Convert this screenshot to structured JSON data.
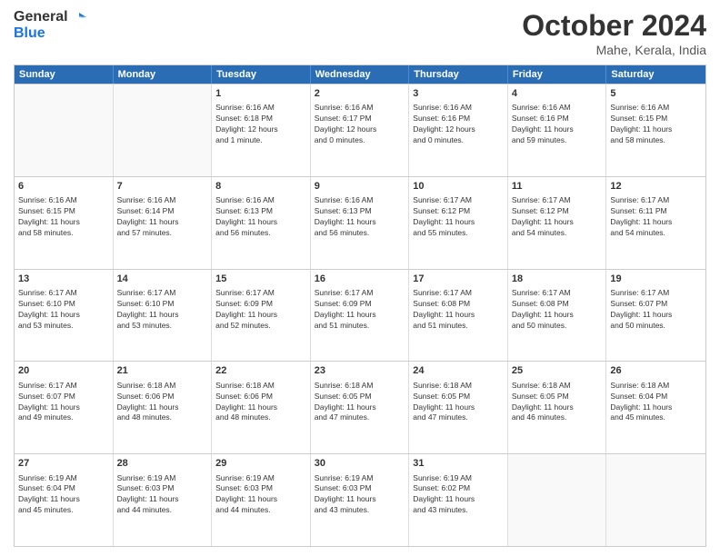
{
  "logo": {
    "line1": "General",
    "line2": "Blue"
  },
  "title": "October 2024",
  "subtitle": "Mahe, Kerala, India",
  "header_days": [
    "Sunday",
    "Monday",
    "Tuesday",
    "Wednesday",
    "Thursday",
    "Friday",
    "Saturday"
  ],
  "weeks": [
    [
      {
        "day": "",
        "empty": true
      },
      {
        "day": "",
        "empty": true
      },
      {
        "day": "1",
        "l1": "Sunrise: 6:16 AM",
        "l2": "Sunset: 6:18 PM",
        "l3": "Daylight: 12 hours",
        "l4": "and 1 minute."
      },
      {
        "day": "2",
        "l1": "Sunrise: 6:16 AM",
        "l2": "Sunset: 6:17 PM",
        "l3": "Daylight: 12 hours",
        "l4": "and 0 minutes."
      },
      {
        "day": "3",
        "l1": "Sunrise: 6:16 AM",
        "l2": "Sunset: 6:16 PM",
        "l3": "Daylight: 12 hours",
        "l4": "and 0 minutes."
      },
      {
        "day": "4",
        "l1": "Sunrise: 6:16 AM",
        "l2": "Sunset: 6:16 PM",
        "l3": "Daylight: 11 hours",
        "l4": "and 59 minutes."
      },
      {
        "day": "5",
        "l1": "Sunrise: 6:16 AM",
        "l2": "Sunset: 6:15 PM",
        "l3": "Daylight: 11 hours",
        "l4": "and 58 minutes."
      }
    ],
    [
      {
        "day": "6",
        "l1": "Sunrise: 6:16 AM",
        "l2": "Sunset: 6:15 PM",
        "l3": "Daylight: 11 hours",
        "l4": "and 58 minutes."
      },
      {
        "day": "7",
        "l1": "Sunrise: 6:16 AM",
        "l2": "Sunset: 6:14 PM",
        "l3": "Daylight: 11 hours",
        "l4": "and 57 minutes."
      },
      {
        "day": "8",
        "l1": "Sunrise: 6:16 AM",
        "l2": "Sunset: 6:13 PM",
        "l3": "Daylight: 11 hours",
        "l4": "and 56 minutes."
      },
      {
        "day": "9",
        "l1": "Sunrise: 6:16 AM",
        "l2": "Sunset: 6:13 PM",
        "l3": "Daylight: 11 hours",
        "l4": "and 56 minutes."
      },
      {
        "day": "10",
        "l1": "Sunrise: 6:17 AM",
        "l2": "Sunset: 6:12 PM",
        "l3": "Daylight: 11 hours",
        "l4": "and 55 minutes."
      },
      {
        "day": "11",
        "l1": "Sunrise: 6:17 AM",
        "l2": "Sunset: 6:12 PM",
        "l3": "Daylight: 11 hours",
        "l4": "and 54 minutes."
      },
      {
        "day": "12",
        "l1": "Sunrise: 6:17 AM",
        "l2": "Sunset: 6:11 PM",
        "l3": "Daylight: 11 hours",
        "l4": "and 54 minutes."
      }
    ],
    [
      {
        "day": "13",
        "l1": "Sunrise: 6:17 AM",
        "l2": "Sunset: 6:10 PM",
        "l3": "Daylight: 11 hours",
        "l4": "and 53 minutes."
      },
      {
        "day": "14",
        "l1": "Sunrise: 6:17 AM",
        "l2": "Sunset: 6:10 PM",
        "l3": "Daylight: 11 hours",
        "l4": "and 53 minutes."
      },
      {
        "day": "15",
        "l1": "Sunrise: 6:17 AM",
        "l2": "Sunset: 6:09 PM",
        "l3": "Daylight: 11 hours",
        "l4": "and 52 minutes."
      },
      {
        "day": "16",
        "l1": "Sunrise: 6:17 AM",
        "l2": "Sunset: 6:09 PM",
        "l3": "Daylight: 11 hours",
        "l4": "and 51 minutes."
      },
      {
        "day": "17",
        "l1": "Sunrise: 6:17 AM",
        "l2": "Sunset: 6:08 PM",
        "l3": "Daylight: 11 hours",
        "l4": "and 51 minutes."
      },
      {
        "day": "18",
        "l1": "Sunrise: 6:17 AM",
        "l2": "Sunset: 6:08 PM",
        "l3": "Daylight: 11 hours",
        "l4": "and 50 minutes."
      },
      {
        "day": "19",
        "l1": "Sunrise: 6:17 AM",
        "l2": "Sunset: 6:07 PM",
        "l3": "Daylight: 11 hours",
        "l4": "and 50 minutes."
      }
    ],
    [
      {
        "day": "20",
        "l1": "Sunrise: 6:17 AM",
        "l2": "Sunset: 6:07 PM",
        "l3": "Daylight: 11 hours",
        "l4": "and 49 minutes."
      },
      {
        "day": "21",
        "l1": "Sunrise: 6:18 AM",
        "l2": "Sunset: 6:06 PM",
        "l3": "Daylight: 11 hours",
        "l4": "and 48 minutes."
      },
      {
        "day": "22",
        "l1": "Sunrise: 6:18 AM",
        "l2": "Sunset: 6:06 PM",
        "l3": "Daylight: 11 hours",
        "l4": "and 48 minutes."
      },
      {
        "day": "23",
        "l1": "Sunrise: 6:18 AM",
        "l2": "Sunset: 6:05 PM",
        "l3": "Daylight: 11 hours",
        "l4": "and 47 minutes."
      },
      {
        "day": "24",
        "l1": "Sunrise: 6:18 AM",
        "l2": "Sunset: 6:05 PM",
        "l3": "Daylight: 11 hours",
        "l4": "and 47 minutes."
      },
      {
        "day": "25",
        "l1": "Sunrise: 6:18 AM",
        "l2": "Sunset: 6:05 PM",
        "l3": "Daylight: 11 hours",
        "l4": "and 46 minutes."
      },
      {
        "day": "26",
        "l1": "Sunrise: 6:18 AM",
        "l2": "Sunset: 6:04 PM",
        "l3": "Daylight: 11 hours",
        "l4": "and 45 minutes."
      }
    ],
    [
      {
        "day": "27",
        "l1": "Sunrise: 6:19 AM",
        "l2": "Sunset: 6:04 PM",
        "l3": "Daylight: 11 hours",
        "l4": "and 45 minutes."
      },
      {
        "day": "28",
        "l1": "Sunrise: 6:19 AM",
        "l2": "Sunset: 6:03 PM",
        "l3": "Daylight: 11 hours",
        "l4": "and 44 minutes."
      },
      {
        "day": "29",
        "l1": "Sunrise: 6:19 AM",
        "l2": "Sunset: 6:03 PM",
        "l3": "Daylight: 11 hours",
        "l4": "and 44 minutes."
      },
      {
        "day": "30",
        "l1": "Sunrise: 6:19 AM",
        "l2": "Sunset: 6:03 PM",
        "l3": "Daylight: 11 hours",
        "l4": "and 43 minutes."
      },
      {
        "day": "31",
        "l1": "Sunrise: 6:19 AM",
        "l2": "Sunset: 6:02 PM",
        "l3": "Daylight: 11 hours",
        "l4": "and 43 minutes."
      },
      {
        "day": "",
        "empty": true
      },
      {
        "day": "",
        "empty": true
      }
    ]
  ]
}
